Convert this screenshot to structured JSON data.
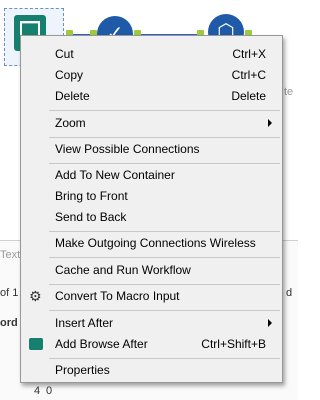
{
  "background": {
    "right_text": "te",
    "right_text2": "d",
    "left_tab": "Text",
    "left_of": "of 1",
    "left_ord": "ord",
    "row_number": "4",
    "row_value": "0",
    "tool_symbol": "✓",
    "tool_symbol_2": "⬡"
  },
  "menu": {
    "items": [
      {
        "label": "Cut",
        "shortcut": "Ctrl+X"
      },
      {
        "label": "Copy",
        "shortcut": "Ctrl+C"
      },
      {
        "label": "Delete",
        "shortcut": "Delete"
      },
      {
        "label": "Zoom"
      },
      {
        "label": "View Possible Connections"
      },
      {
        "label": "Add To New Container"
      },
      {
        "label": "Bring to Front"
      },
      {
        "label": "Send to Back"
      },
      {
        "label": "Make Outgoing Connections Wireless"
      },
      {
        "label": "Cache and Run Workflow"
      },
      {
        "label": "Convert To Macro Input",
        "icon": "gear-icon"
      },
      {
        "label": "Insert After"
      },
      {
        "label": "Add Browse After",
        "shortcut": "Ctrl+Shift+B",
        "icon": "binoculars-icon"
      },
      {
        "label": "Properties"
      }
    ]
  },
  "colors": {
    "menu_bg": "#f0f0f0",
    "tool_green": "#16806e",
    "tool_blue": "#1e5aa8",
    "connection_blue": "#2d5fd0",
    "anchor_green": "#9ccc3c"
  }
}
